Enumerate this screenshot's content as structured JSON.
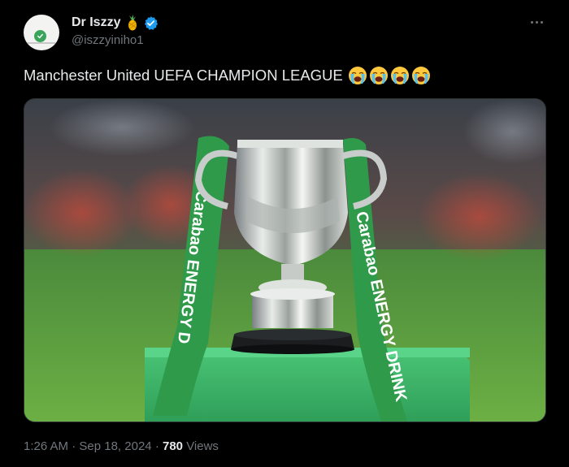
{
  "author": {
    "display_name": "Dr Iszzy",
    "handle": "@iszzyiniho1"
  },
  "tweet": {
    "text": "Manchester United UEFA CHAMPION LEAGUE",
    "emojis": [
      "loudly-crying-face",
      "loudly-crying-face",
      "loudly-crying-face",
      "loudly-crying-face"
    ]
  },
  "media": {
    "ribbon_left_text": "Carabao ENERGY D",
    "ribbon_right_text": "Carabao ENERGY DRINK",
    "icon": "trophy-photo"
  },
  "meta": {
    "time": "1:26 AM",
    "sep1": "·",
    "date": "Sep 18, 2024",
    "sep2": "·",
    "views_count": "780",
    "views_label": "Views"
  },
  "colors": {
    "background": "#000000",
    "text_primary": "#e7e9ea",
    "text_secondary": "#71767b",
    "verified": "#1d9bf0",
    "ribbon_green": "#2e9a4a",
    "plinth_green": "#3cb968"
  }
}
